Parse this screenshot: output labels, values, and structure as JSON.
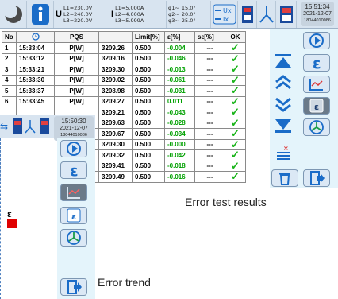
{
  "top_status": {
    "voltage": [
      "U",
      "L1=230.0V",
      "L2=240.0V",
      "L3=220.0V"
    ],
    "current": [
      "I",
      "L1=5.000A",
      "L2=4.000A",
      "L3=5.999A"
    ],
    "phi": [
      "φ1~",
      "φ2~",
      "φ3~"
    ],
    "phi_values": [
      "15.0°",
      "20.0°",
      "25.0°"
    ],
    "time": "15:51:34",
    "date": "2021-12-07",
    "serial": "18044010086"
  },
  "table": {
    "headers": [
      "No",
      "PQS",
      "",
      "Limit[%]",
      "ε[%]",
      "sε[%]",
      "OK"
    ],
    "rows": [
      {
        "no": "1",
        "time": "15:33:04",
        "pqs": "P[W]",
        "value": "3209.26",
        "limit": "0.500",
        "eps": "-0.004",
        "seps": "---"
      },
      {
        "no": "2",
        "time": "15:33:12",
        "pqs": "P[W]",
        "value": "3209.16",
        "limit": "0.500",
        "eps": "-0.046",
        "seps": "---"
      },
      {
        "no": "3",
        "time": "15:33:21",
        "pqs": "P[W]",
        "value": "3209.30",
        "limit": "0.500",
        "eps": "-0.013",
        "seps": "---"
      },
      {
        "no": "4",
        "time": "15:33:30",
        "pqs": "P[W]",
        "value": "3209.02",
        "limit": "0.500",
        "eps": "-0.061",
        "seps": "---"
      },
      {
        "no": "5",
        "time": "15:33:37",
        "pqs": "P[W]",
        "value": "3208.98",
        "limit": "0.500",
        "eps": "-0.031",
        "seps": "---"
      },
      {
        "no": "6",
        "time": "15:33:45",
        "pqs": "P[W]",
        "value": "3209.27",
        "limit": "0.500",
        "eps": "0.011",
        "seps": "---"
      },
      {
        "no": "",
        "time": "",
        "pqs": "",
        "value": "3209.21",
        "limit": "0.500",
        "eps": "-0.043",
        "seps": "---"
      },
      {
        "no": "",
        "time": "",
        "pqs": "",
        "value": "3209.63",
        "limit": "0.500",
        "eps": "-0.028",
        "seps": "---"
      },
      {
        "no": "",
        "time": "",
        "pqs": "",
        "value": "3209.67",
        "limit": "0.500",
        "eps": "-0.034",
        "seps": "---"
      },
      {
        "no": "",
        "time": "",
        "pqs": "",
        "value": "3209.30",
        "limit": "0.500",
        "eps": "-0.000",
        "seps": "---"
      },
      {
        "no": "",
        "time": "",
        "pqs": "",
        "value": "3209.32",
        "limit": "0.500",
        "eps": "-0.042",
        "seps": "---"
      },
      {
        "no": "",
        "time": "",
        "pqs": "",
        "value": "3209.41",
        "limit": "0.500",
        "eps": "-0.018",
        "seps": "---"
      },
      {
        "no": "",
        "time": "",
        "pqs": "",
        "value": "3209.49",
        "limit": "0.500",
        "eps": "-0.016",
        "seps": "---"
      }
    ]
  },
  "overlay": {
    "time": "15:50:30",
    "date": "2021-12-07",
    "serial": "18044010086",
    "epsilon_label": "ε"
  },
  "labels": {
    "error_test_results": "Error test results",
    "error_trend": "Error trend"
  },
  "colors": {
    "accent": "#0b5fa8",
    "ok_green": "#19b419",
    "panel_bg": "#d8e4f0",
    "side_bg": "#e4f4fb"
  }
}
